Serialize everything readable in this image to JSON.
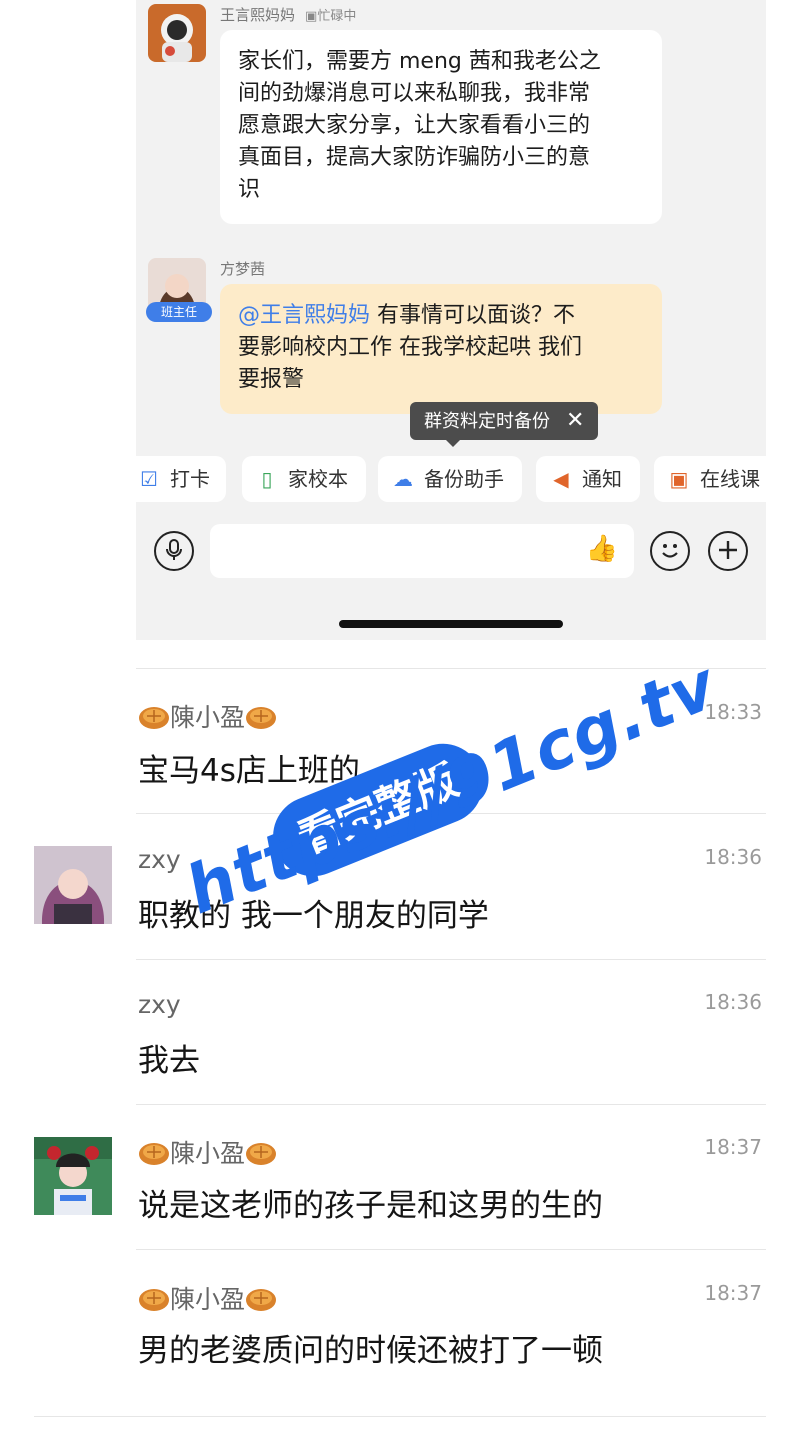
{
  "chat_screenshot": {
    "messages": [
      {
        "sender": "王言熙妈妈",
        "status": "忙碌中",
        "text_lines": [
          "家长们，需要方 meng 茜和我老公之",
          "间的劲爆消息可以来私聊我，我非常",
          "愿意跟大家分享，让大家看看小三的",
          "真面目，提高大家防诈骗防小三的意",
          "识"
        ]
      },
      {
        "sender": "方梦茜",
        "role_badge": "班主任",
        "mention": "@王言熙妈妈",
        "text_lines": [
          " 有事情可以面谈？不",
          "要影响校内工作  在我学校起哄  我们",
          "要报警"
        ]
      }
    ],
    "tooltip": {
      "text": "群资料定时备份",
      "close": "✕"
    },
    "toolbar": [
      {
        "icon": "calendar-check-icon",
        "label": "打卡"
      },
      {
        "icon": "notebook-icon",
        "label": "家校本"
      },
      {
        "icon": "cloud-backup-icon",
        "label": "备份助手"
      },
      {
        "icon": "megaphone-icon",
        "label": "通知"
      },
      {
        "icon": "presentation-icon",
        "label": "在线课"
      }
    ],
    "colors": {
      "mention": "#3f7ee8",
      "teacher_bubble": "#fdebc9",
      "badge": "#3f7ee8"
    }
  },
  "comments": [
    {
      "name": "陳小盈",
      "time": "18:33",
      "text": "宝马4s店上班的",
      "has_avatar": false,
      "mooncakes": true
    },
    {
      "name": "zxy",
      "time": "18:36",
      "text": "职教的 我一个朋友的同学",
      "has_avatar": true,
      "mooncakes": false
    },
    {
      "name": "zxy",
      "time": "18:36",
      "text": "我去",
      "has_avatar": false,
      "mooncakes": false
    },
    {
      "name": "陳小盈",
      "time": "18:37",
      "text": "说是这老师的孩子是和这男的生的",
      "has_avatar": true,
      "mooncakes": true
    },
    {
      "name": "陳小盈",
      "time": "18:37",
      "text": "男的老婆质问的时候还被打了一顿",
      "has_avatar": false,
      "mooncakes": true
    }
  ],
  "watermark": {
    "badge": "看完整版",
    "url": "https://91cg.tv",
    "color": "#1f6be8"
  }
}
